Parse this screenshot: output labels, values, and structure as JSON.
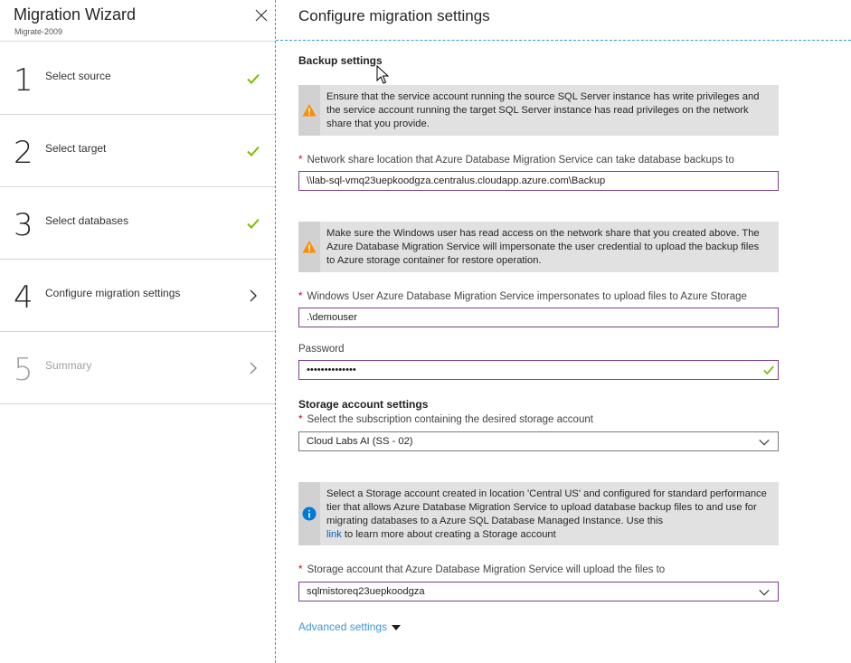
{
  "wizard": {
    "title": "Migration Wizard",
    "subtitle": "Migrate-2009",
    "steps": [
      {
        "num": "1",
        "label": "Select source",
        "status": "complete"
      },
      {
        "num": "2",
        "label": "Select target",
        "status": "complete"
      },
      {
        "num": "3",
        "label": "Select databases",
        "status": "complete"
      },
      {
        "num": "4",
        "label": "Configure migration settings",
        "status": "current"
      },
      {
        "num": "5",
        "label": "Summary",
        "status": "disabled"
      }
    ]
  },
  "main": {
    "title": "Configure migration settings",
    "backup": {
      "heading": "Backup settings",
      "warning1": "Ensure that the service account running the source SQL Server instance has write privileges and the service account running the target SQL Server instance has read privileges on the network share that you provide.",
      "share_label": "Network share location that Azure Database Migration Service can take database backups to",
      "share_value": "\\\\lab-sql-vmq23uepkoodgza.centralus.cloudapp.azure.com\\Backup",
      "warning2": "Make sure the Windows user has read access on the network share that you created above. The Azure Database Migration Service will impersonate the user credential to upload the backup files to Azure storage container for restore operation.",
      "user_label": "Windows User Azure Database Migration Service impersonates to upload files to Azure Storage",
      "user_value": ".\\demouser",
      "password_label": "Password",
      "password_value": "••••••••••••••"
    },
    "storage": {
      "heading": "Storage account settings",
      "subscription_label": "Select the subscription containing the desired storage account",
      "subscription_value": "Cloud Labs AI (SS - 02)",
      "info_text": "Select a Storage account created in location 'Central US' and configured for standard performance tier that allows Azure Database Migration Service to upload database backup files to and use for migrating databases to a Azure SQL Database Managed Instance. Use this",
      "info_link": "link",
      "info_text_after": " to learn more about creating a Storage account",
      "account_label": "Storage account that Azure Database Migration Service will upload the files to",
      "account_value": "sqlmistoreq23uepkoodgza"
    },
    "advanced_label": "Advanced settings"
  },
  "colors": {
    "accent": "#3a96dd",
    "check": "#7fba00",
    "warning": "#ff8c00",
    "info": "#0078d7",
    "input_border": "#7a3f8b"
  }
}
